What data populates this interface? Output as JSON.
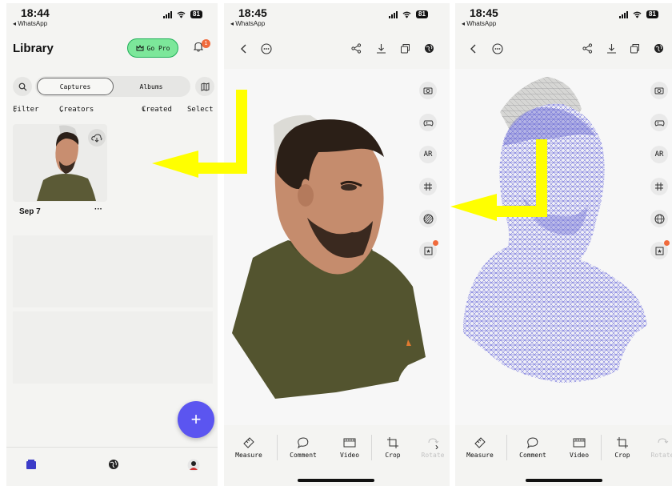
{
  "screens": {
    "library": {
      "status": {
        "time": "18:44",
        "back_app": "◂ WhatsApp",
        "battery": "81"
      },
      "title": "Library",
      "gopro_label": "Go Pro",
      "notification_count": "1",
      "segments": [
        "Captures",
        "Albums"
      ],
      "filter_label": "Filter",
      "creators_label": "Creators",
      "sort_label": "Created",
      "select_label": "Select",
      "capture": {
        "date": "Sep 7",
        "more": "···"
      },
      "fab_label": "+"
    },
    "viewer_textured": {
      "status": {
        "time": "18:45",
        "back_app": "◂ WhatsApp",
        "battery": "81"
      },
      "side_buttons": [
        "camera",
        "gamepad",
        "AR",
        "grid",
        "wireframe",
        "ar-box"
      ]
    },
    "viewer_wireframe": {
      "status": {
        "time": "18:45",
        "back_app": "◂ WhatsApp",
        "battery": "81"
      },
      "side_buttons": [
        "camera",
        "gamepad",
        "AR",
        "grid",
        "globe",
        "ar-box"
      ]
    }
  },
  "toolbar": {
    "measure": "Measure",
    "comment": "Comment",
    "video": "Video",
    "crop": "Crop",
    "rotate": "Rotate"
  },
  "side": {
    "ar_label": "AR"
  },
  "colors": {
    "accent": "#5b55f0",
    "gopro_bg": "#7ce79a",
    "badge": "#f06a3c",
    "arrow": "#ffff00",
    "wire": "#5a5ad6"
  },
  "icons": [
    "search-icon",
    "map-icon",
    "crown-icon",
    "bell-icon",
    "cloud-download-icon",
    "library-icon",
    "globe-icon",
    "profile-icon",
    "back-icon",
    "more-icon",
    "share-icon",
    "download-icon",
    "export-icon",
    "camera-icon",
    "gamepad-icon",
    "grid-icon",
    "wireframe-icon",
    "ar-box-icon",
    "ruler-icon",
    "comment-icon",
    "video-icon",
    "crop-icon",
    "rotate-icon",
    "chevron-right-icon"
  ]
}
